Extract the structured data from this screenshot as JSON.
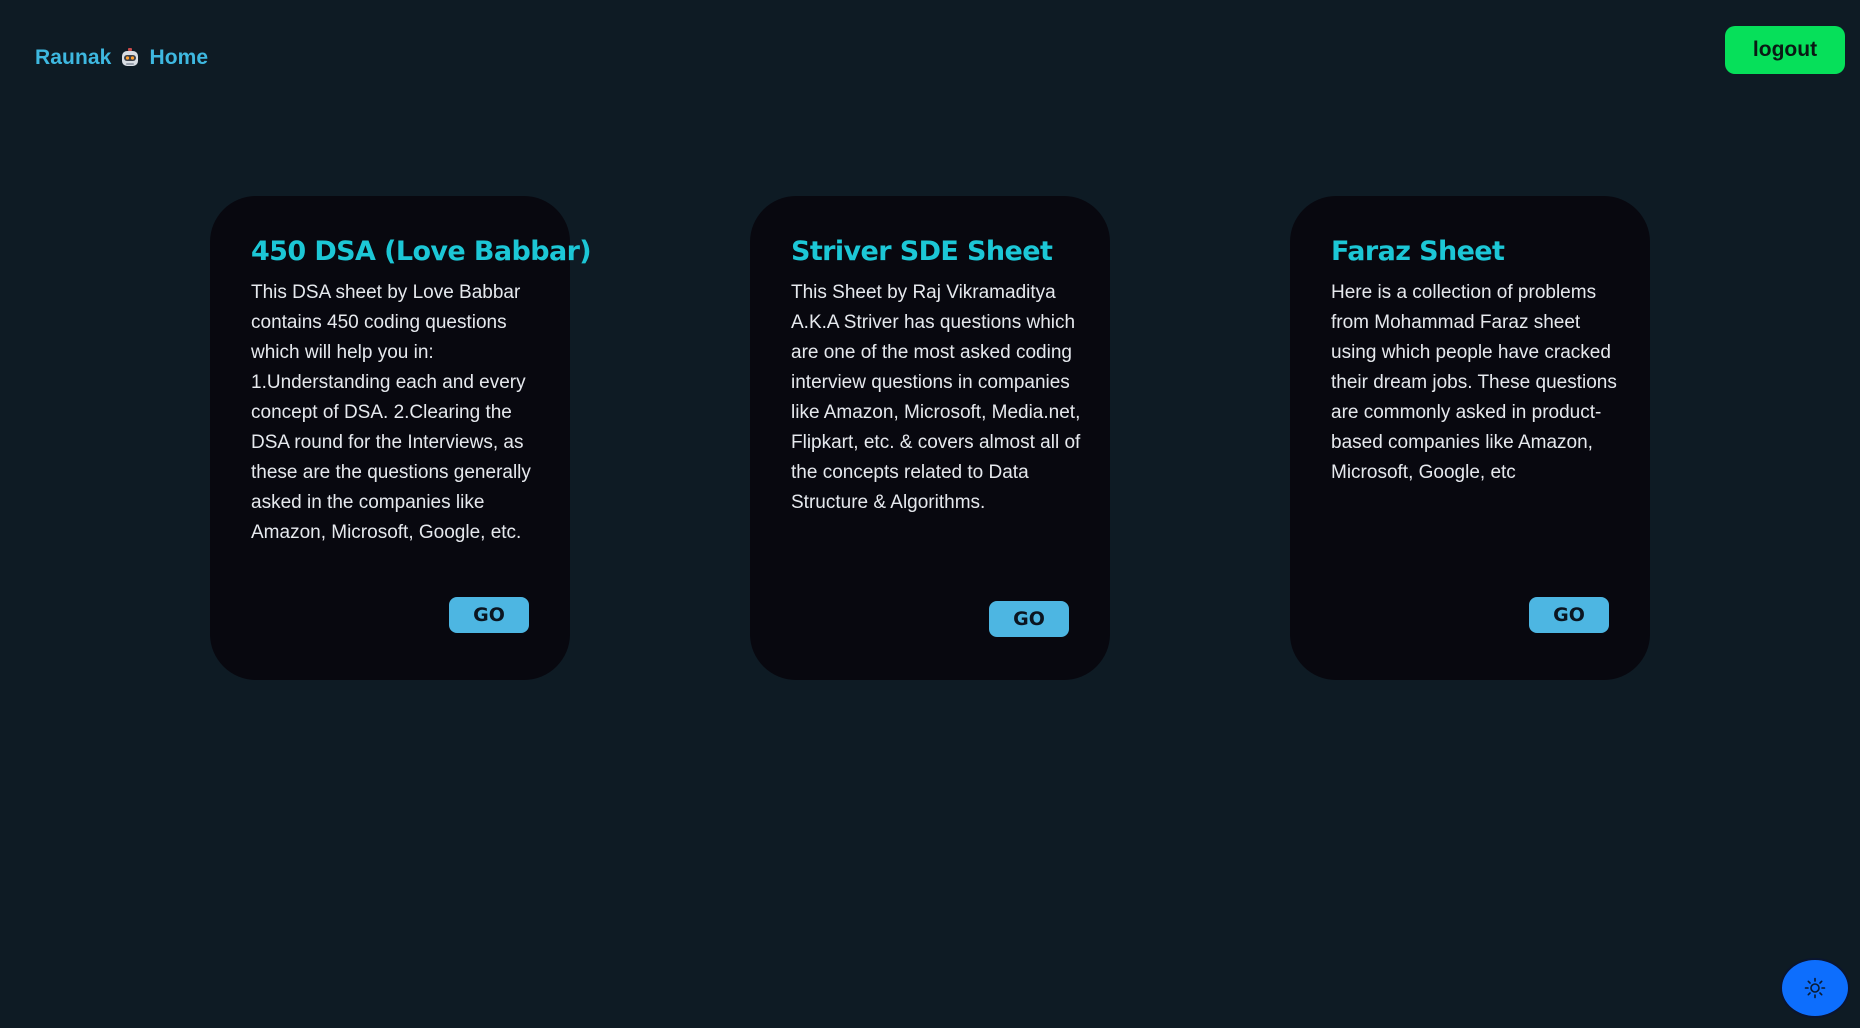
{
  "nav": {
    "user_name": "Raunak",
    "home_label": "Home",
    "logout_label": "logout"
  },
  "cards": [
    {
      "title": "450 DSA (Love Babbar)",
      "description": "This DSA sheet by Love Babbar contains 450 coding questions which will help you in: 1.Understanding each and every concept of DSA. 2.Clearing the DSA round for the Interviews, as these are the questions generally asked in the companies like Amazon, Microsoft, Google, etc.",
      "button_label": "GO"
    },
    {
      "title": "Striver SDE Sheet",
      "description": "This Sheet by Raj Vikramaditya A.K.A Striver has questions which are one of the most asked coding interview questions in companies like Amazon, Microsoft, Media.net, Flipkart, etc. & covers almost all of the concepts related to Data Structure & Algorithms.",
      "button_label": "GO"
    },
    {
      "title": "Faraz Sheet",
      "description": "Here is a collection of problems from Mohammad Faraz sheet using which people have cracked their dream jobs. These questions are commonly asked in product-based companies like Amazon, Microsoft, Google, etc",
      "button_label": "GO"
    }
  ],
  "theme_toggle": {
    "icon": "sun-icon"
  },
  "colors": {
    "background": "#0e1b24",
    "card": "#08080f",
    "title_accent": "#1cc7d6",
    "nav_accent": "#3eb8e0",
    "logout": "#06e05a",
    "go_button": "#4db6e2",
    "toggle": "#0d6efd"
  }
}
